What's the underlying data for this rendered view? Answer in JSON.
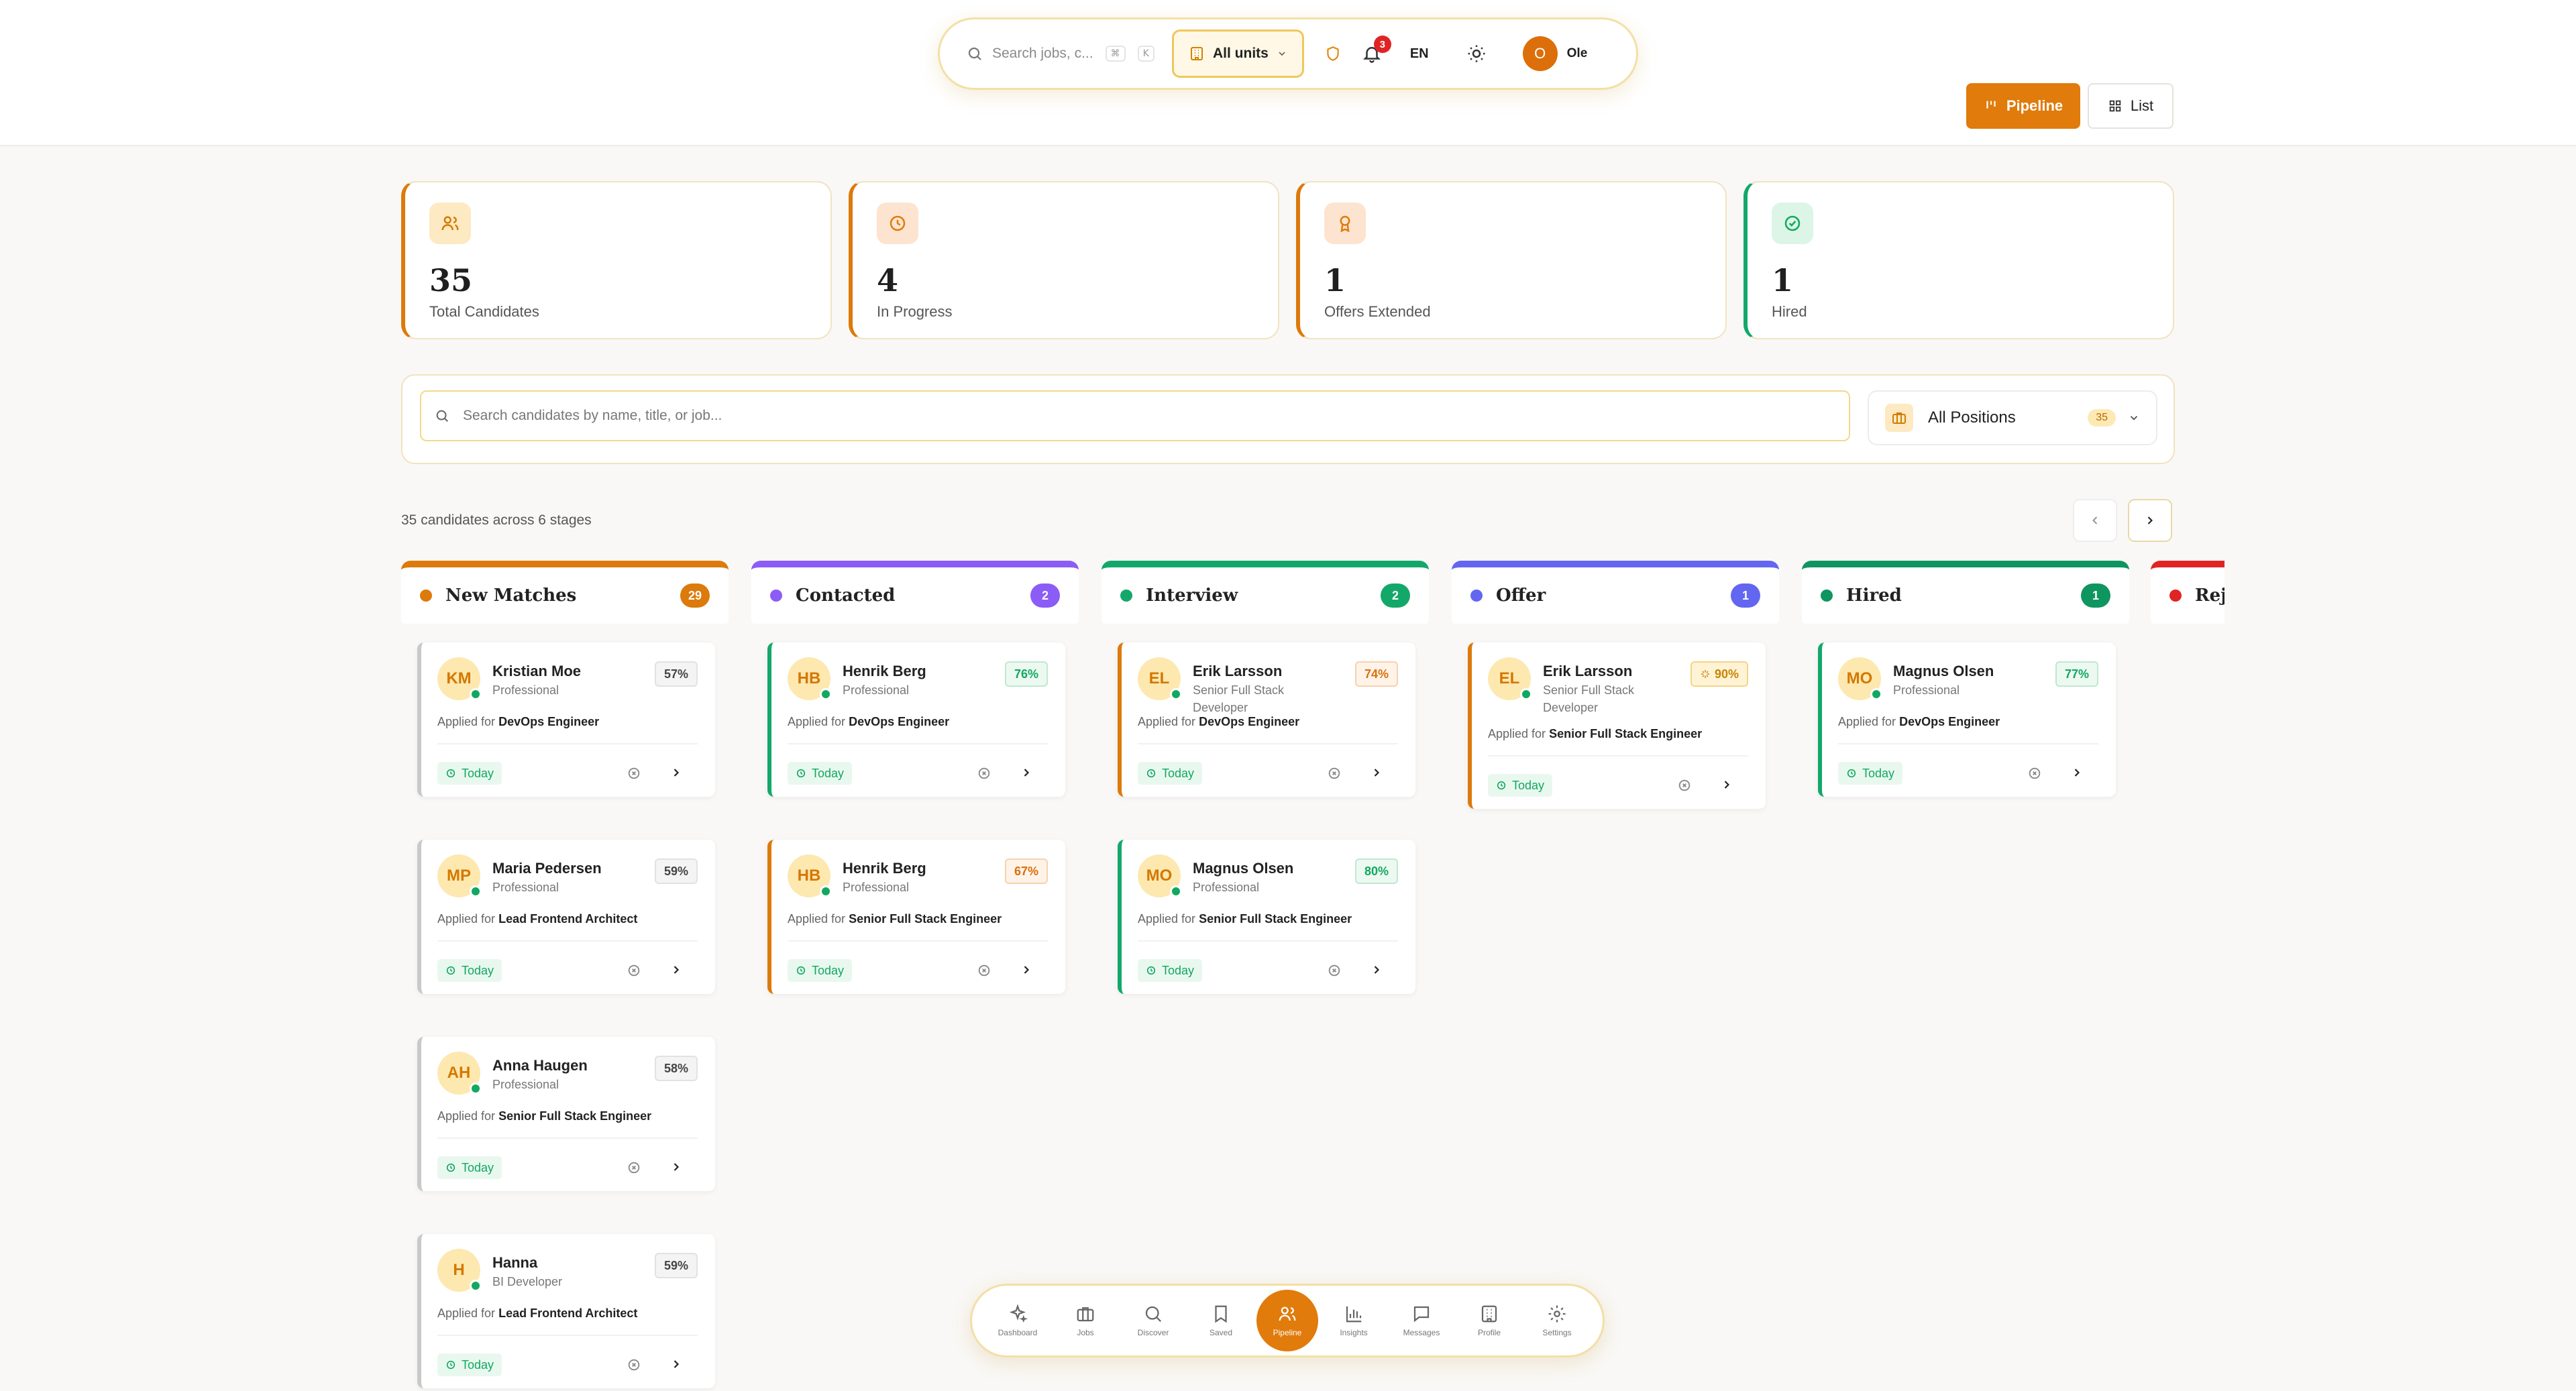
{
  "topbar": {
    "search_placeholder": "Search jobs, c...",
    "kbd1": "⌘",
    "kbd2": "K",
    "units": "All units",
    "notif_count": "3",
    "lang": "EN",
    "user_initial": "O",
    "user_name": "Ole"
  },
  "view": {
    "pipeline": "Pipeline",
    "list": "List"
  },
  "stats": [
    {
      "value": "35",
      "label": "Total Candidates"
    },
    {
      "value": "4",
      "label": "In Progress"
    },
    {
      "value": "1",
      "label": "Offers Extended"
    },
    {
      "value": "1",
      "label": "Hired"
    }
  ],
  "filter": {
    "search_placeholder": "Search candidates by name, title, or job...",
    "positions": "All Positions",
    "positions_count": "35"
  },
  "summary": "35 candidates across 6 stages",
  "applied_prefix": "Applied for",
  "today": "Today",
  "columns": [
    {
      "title": "New Matches",
      "count": "29",
      "color": "#dc7a0c"
    },
    {
      "title": "Contacted",
      "count": "2",
      "color": "#8b5cf6"
    },
    {
      "title": "Interview",
      "count": "2",
      "color": "#13a86a"
    },
    {
      "title": "Offer",
      "count": "1",
      "color": "#6366f1"
    },
    {
      "title": "Hired",
      "count": "1",
      "color": "#0f9560"
    },
    {
      "title": "Rejected",
      "color": "#e02424"
    }
  ],
  "cards": {
    "new": [
      {
        "initials": "KM",
        "name": "Kristian Moe",
        "role": "Professional",
        "match": "57%",
        "job": "DevOps Engineer"
      },
      {
        "initials": "MP",
        "name": "Maria Pedersen",
        "role": "Professional",
        "match": "59%",
        "job": "Lead Frontend Architect"
      },
      {
        "initials": "AH",
        "name": "Anna Haugen",
        "role": "Professional",
        "match": "58%",
        "job": "Senior Full Stack Engineer"
      },
      {
        "initials": "H",
        "name": "Hanna",
        "role": "BI Developer",
        "match": "59%",
        "job": "Lead Frontend Architect"
      }
    ],
    "contacted": [
      {
        "initials": "HB",
        "name": "Henrik Berg",
        "role": "Professional",
        "match": "76%",
        "job": "DevOps Engineer"
      },
      {
        "initials": "HB",
        "name": "Henrik Berg",
        "role": "Professional",
        "match": "67%",
        "job": "Senior Full Stack Engineer"
      }
    ],
    "interview": [
      {
        "initials": "EL",
        "name": "Erik Larsson",
        "role": "Senior Full Stack Developer",
        "match": "74%",
        "job": "DevOps Engineer"
      },
      {
        "initials": "MO",
        "name": "Magnus Olsen",
        "role": "Professional",
        "match": "80%",
        "job": "Senior Full Stack Engineer"
      }
    ],
    "offer": [
      {
        "initials": "EL",
        "name": "Erik Larsson",
        "role": "Senior Full Stack Developer",
        "match": "90%",
        "job": "Senior Full Stack Engineer"
      }
    ],
    "hired": [
      {
        "initials": "MO",
        "name": "Magnus Olsen",
        "role": "Professional",
        "match": "77%",
        "job": "DevOps Engineer"
      }
    ]
  },
  "nav": [
    {
      "label": "Dashboard",
      "icon": "sparkles-icon"
    },
    {
      "label": "Jobs",
      "icon": "briefcase-icon"
    },
    {
      "label": "Discover",
      "icon": "search-icon"
    },
    {
      "label": "Saved",
      "icon": "bookmark-icon"
    },
    {
      "label": "Pipeline",
      "icon": "users-icon",
      "active": true
    },
    {
      "label": "Insights",
      "icon": "bar-chart-icon"
    },
    {
      "label": "Messages",
      "icon": "message-icon"
    },
    {
      "label": "Profile",
      "icon": "building-icon"
    },
    {
      "label": "Settings",
      "icon": "gear-icon"
    }
  ]
}
